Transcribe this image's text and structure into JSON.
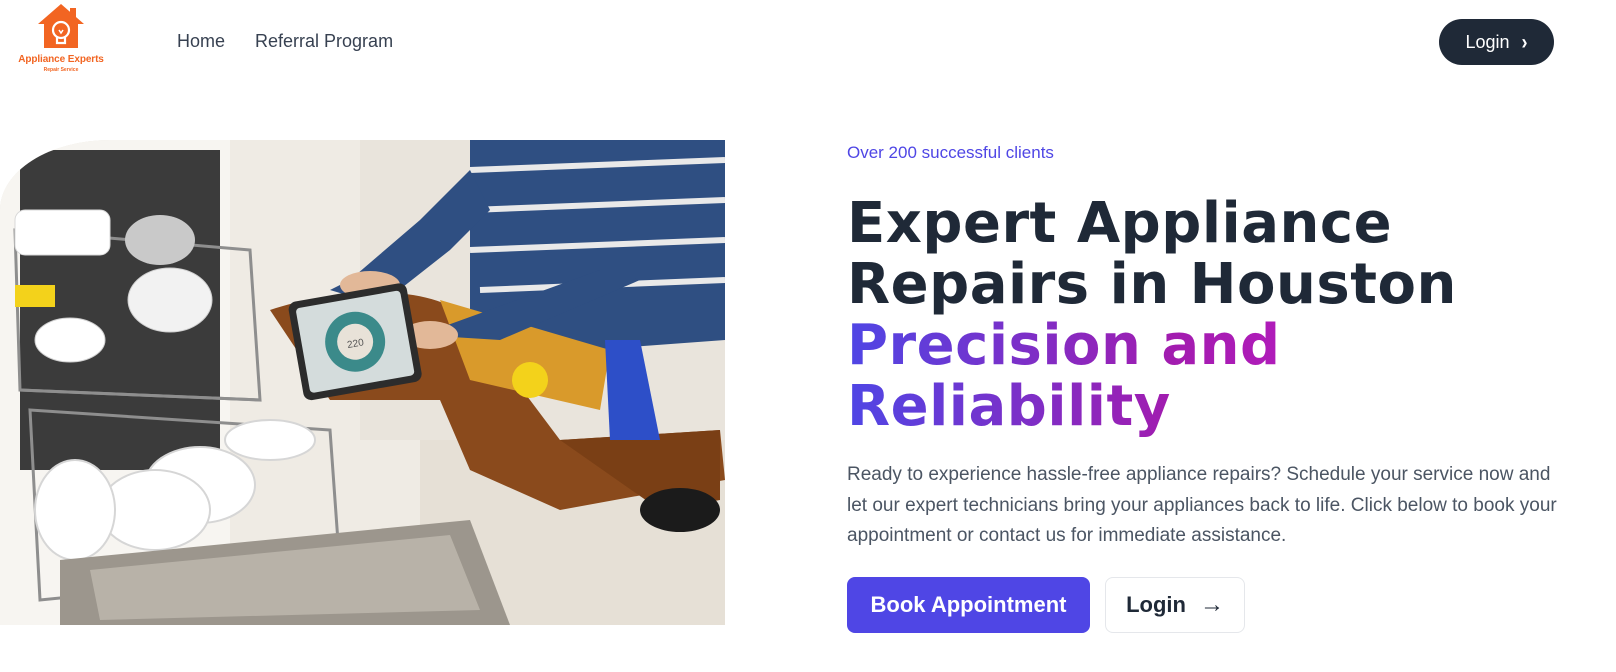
{
  "brand": {
    "name": "Appliance Experts",
    "tagline": "Repair Service",
    "color": "#f26522",
    "logo_icon": "house-lightbulb-icon"
  },
  "nav": {
    "items": [
      {
        "label": "Home"
      },
      {
        "label": "Referral Program"
      }
    ],
    "login_label": "Login",
    "login_icon": "chevron-right-icon"
  },
  "hero": {
    "image": "technician-tablet-dishwasher-photo",
    "kicker": "Over 200 successful clients",
    "title_line1": "Expert Appliance",
    "title_line2": "Repairs in Houston",
    "title_accent_line1": "Precision and",
    "title_accent_line2": "Reliability",
    "description": "Ready to experience hassle-free appliance repairs? Schedule your service now and let our expert technicians bring your appliances back to life. Click below to book your appointment or contact us for immediate assistance.",
    "primary_button": "Book Appointment",
    "secondary_button": "Login",
    "secondary_icon": "arrow-right-icon"
  },
  "colors": {
    "primary": "#4f46e5",
    "dark": "#1f2937",
    "accent_gradient_start": "#4f46e5",
    "accent_gradient_end": "#d61ad6"
  }
}
